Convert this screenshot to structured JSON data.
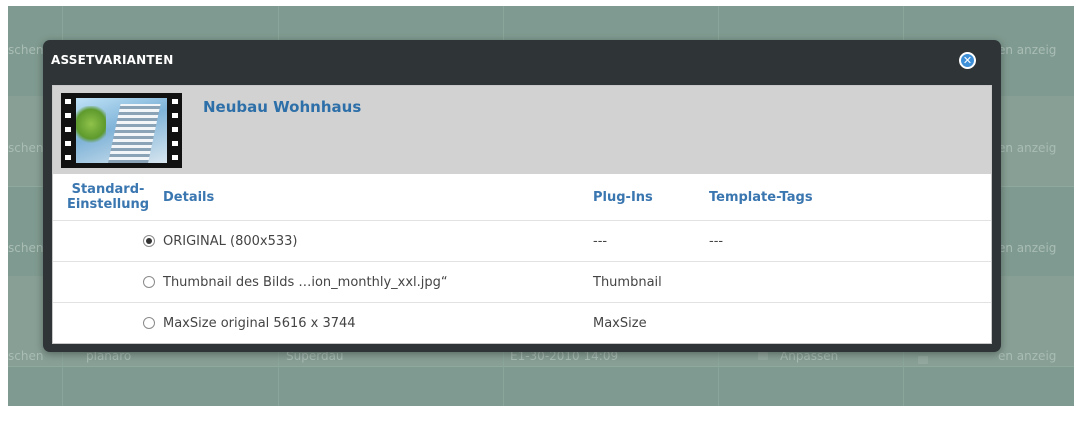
{
  "background": {
    "left_labels": [
      "schen",
      "schen",
      "schen",
      "schen"
    ],
    "right_labels": [
      "en anzeig",
      "en anzeig",
      "en anzeig",
      "en anzeig"
    ],
    "bottom_row": {
      "col1": "planaro",
      "col2": "Superdau",
      "col3": "E1-30-2010 14:09",
      "col4": "Anpassen"
    }
  },
  "modal": {
    "title": "ASSETVARIANTEN",
    "close_icon": "close-circle-icon",
    "asset": {
      "name": "Neubau Wohnhaus",
      "thumbnail_icon": "video-thumbnail-icon"
    },
    "table": {
      "headers": {
        "default_line1": "Standard-",
        "default_line2": "Einstellung",
        "details": "Details",
        "plugins": "Plug-Ins",
        "template_tags": "Template-Tags"
      },
      "rows": [
        {
          "selected": true,
          "details": "ORIGINAL (800x533)",
          "plugins": "---",
          "template_tags": "---"
        },
        {
          "selected": false,
          "details": "Thumbnail des Bilds …ion_monthly_xxl.jpg“",
          "plugins": "Thumbnail",
          "template_tags": ""
        },
        {
          "selected": false,
          "details": "MaxSize original 5616 x 3744",
          "plugins": "MaxSize",
          "template_tags": ""
        }
      ]
    }
  },
  "colors": {
    "accent": "#3a76b0",
    "modal_bg": "#2f3436",
    "overlay": "#7f9a90"
  }
}
